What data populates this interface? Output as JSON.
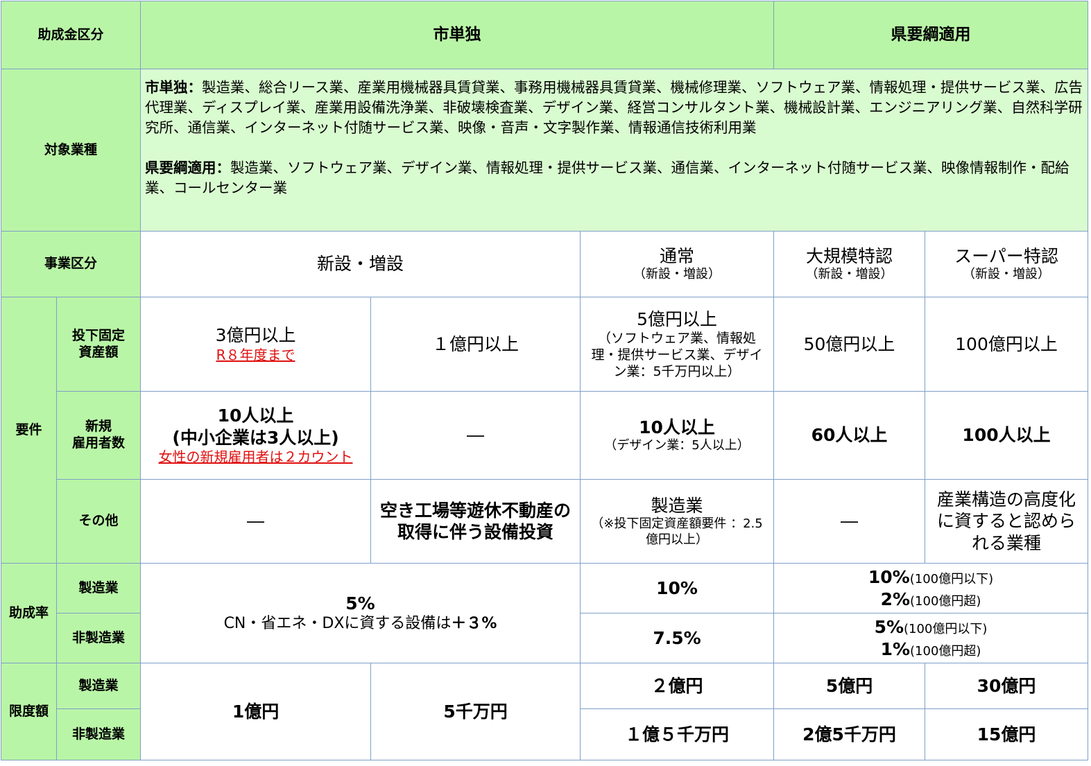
{
  "header": {
    "category_label": "助成金区分",
    "city_only": "市単独",
    "prefecture": "県要綱適用"
  },
  "industries": {
    "row_label": "対象業種",
    "city_title": "市単独：",
    "city_text": "製造業、総合リース業、産業用機械器具賃貸業、事務用機械器具賃貸業、機械修理業、ソフトウェア業、情報処理・提供サービス業、広告代理業、ディスプレイ業、産業用設備洗浄業、非破壊検査業、デザイン業、経営コンサルタント業、機械設計業、エンジニアリング業、自然科学研究所、通信業、インターネット付随サービス業、映像・音声・文字製作業、情報通信技術利用業",
    "pref_title": "県要綱適用：",
    "pref_text": "製造業、ソフトウェア業、デザイン業、情報処理・提供サービス業、通信業、インターネット付随サービス業、映像情報制作・配給業、コールセンター業"
  },
  "business": {
    "row_label": "事業区分",
    "city": "新設・増設",
    "normal": "通常",
    "normal_sub": "（新設・増設）",
    "large": "大規模特認",
    "large_sub": "（新設・増設）",
    "super": "スーパー特認",
    "super_sub": "（新設・増設）"
  },
  "requirements": {
    "group_label": "要件",
    "investment": {
      "label_line1": "投下固定",
      "label_line2": "資産額",
      "c1": "3億円以上",
      "c1_note": "R８年度まで",
      "c2": "１億円以上",
      "normal": "5億円以上",
      "normal_note": "（ソフトウェア業、情報処理・提供サービス業、デザイン業：5千万円以上）",
      "large": "50億円以上",
      "super": "100億円以上"
    },
    "hiring": {
      "label_line1": "新規",
      "label_line2": "雇用者数",
      "c1_line1": "10人以上",
      "c1_line2": "(中小企業は3人以上)",
      "c1_note": "女性の新規雇用者は２カウント",
      "c2": "―",
      "normal": "10人以上",
      "normal_note": "（デザイン業：5人以上）",
      "large": "60人以上",
      "super": "100人以上"
    },
    "other": {
      "label": "その他",
      "c1": "―",
      "c2": "空き工場等遊休不動産の取得に伴う設備投資",
      "normal": "製造業",
      "normal_note": "（※投下固定資産額要件 ：2.5億円以上）",
      "large": "―",
      "super": "産業構造の高度化に資すると認められる業種"
    }
  },
  "rate": {
    "group_label": "助成率",
    "mfg_label": "製造業",
    "nonmfg_label": "非製造業",
    "city_main": "5%",
    "city_note": "CN・省エネ・DXに資する設備は",
    "city_bonus": "＋３%",
    "normal_mfg": "10%",
    "normal_nonmfg": "7.5%",
    "pref_mfg_a": "10%",
    "pref_mfg_a_note": "(100億円以下)",
    "pref_mfg_b": "2%",
    "pref_mfg_b_note": "(100億円超)",
    "pref_nonmfg_a": "5%",
    "pref_nonmfg_a_note": "(100億円以下)",
    "pref_nonmfg_b": "1%",
    "pref_nonmfg_b_note": "(100億円超)"
  },
  "limit": {
    "group_label": "限度額",
    "mfg_label": "製造業",
    "nonmfg_label": "非製造業",
    "c1": "1億円",
    "c2": "5千万円",
    "normal_mfg": "２億円",
    "large_mfg": "5億円",
    "super_mfg": "30億円",
    "normal_nonmfg": "１億５千万円",
    "large_nonmfg": "2億5千万円",
    "super_nonmfg": "15億円"
  },
  "colors": {
    "header_green": "#b9f5a7",
    "light_green": "#d9fbd0",
    "border_blue": "#7f9fc8",
    "note_red": "#e01010"
  }
}
